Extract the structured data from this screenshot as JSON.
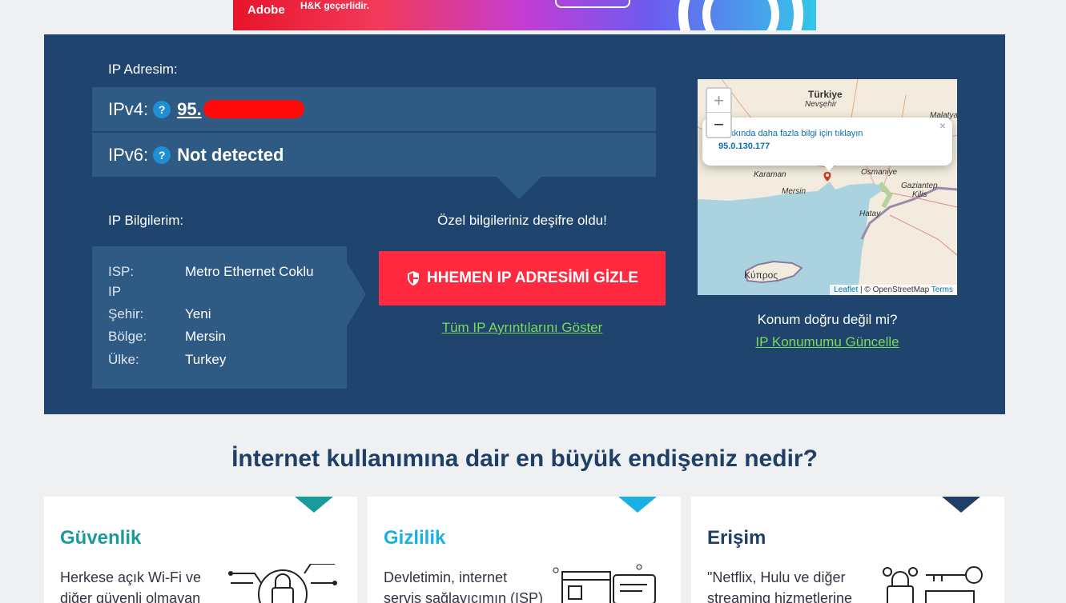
{
  "ad": {
    "brand": "Adobe",
    "text": "H&K geçerlidir."
  },
  "ip": {
    "heading": "IP Adresim:",
    "ipv4_label": "IPv4:",
    "ipv4_value": "95.",
    "ipv6_label": "IPv6:",
    "ipv6_value": "Not detected",
    "help_glyph": "?"
  },
  "info": {
    "heading": "IP Bilgilerim:",
    "rows": [
      {
        "label": "ISP:",
        "value": "Metro Ethernet Coklu",
        "value2": "IP"
      },
      {
        "label": "Şehir:",
        "value": "Yeni"
      },
      {
        "label": "Bölge:",
        "value": "Mersin"
      },
      {
        "label": "Ülke:",
        "value": "Turkey"
      }
    ]
  },
  "actions": {
    "warning": "Özel bilgileriniz deşifre oldu!",
    "hide_button": "HHEMEN IP ADRESİMİ GİZLE",
    "show_all_link": "Tüm IP Ayrıntılarını Göster"
  },
  "map": {
    "zoom_in": "+",
    "zoom_out": "−",
    "popup_text": "Hakkında daha fazla bilgi için tıklayın",
    "popup_ip": "95.0.130.177",
    "popup_close": "×",
    "attribution_leaflet": "Leaflet",
    "attribution_sep": " | © OpenStreetMap ",
    "attribution_terms": "Terms",
    "labels": {
      "turkiye": "Türkiye",
      "nevsehir": "Nevşehir",
      "malatya": "Malatya",
      "karaman": "Karaman",
      "osmaniye": "Osmaniye",
      "mersin": "Mersin",
      "gaziantep": "Gaziantep",
      "kilis": "Kilis",
      "hatay": "Hatay",
      "kibris": "Κύπρος"
    }
  },
  "location": {
    "question": "Konum doğru değil mi?",
    "update_link": "IP Konumumu Güncelle"
  },
  "concerns": {
    "title": "İnternet kullanımına dair en büyük endişeniz nedir?",
    "cards": [
      {
        "title": "Güvenlik",
        "text": "Herkese açık Wi-Fi ve diğer güvenli olmayan",
        "color": "#1a9b9b"
      },
      {
        "title": "Gizlilik",
        "text": "Devletimin, internet servis sağlayıcımın (ISP)",
        "color": "#1ab0e6"
      },
      {
        "title": "Erişim",
        "text": "\"Netflix, Hulu ve diğer streaming hizmetlerine",
        "color": "#1f3f66"
      }
    ]
  }
}
